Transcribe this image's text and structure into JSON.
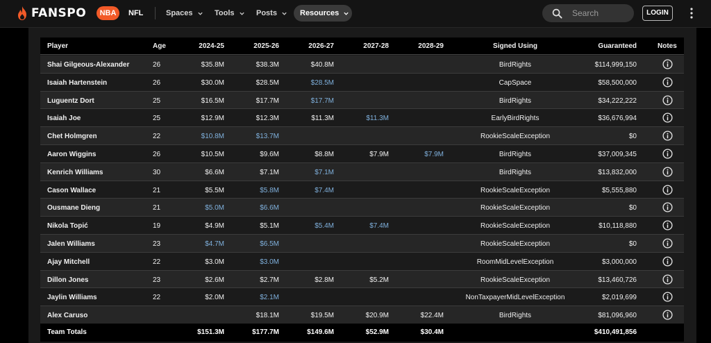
{
  "header": {
    "brand": "FANSPO",
    "league_active": "NBA",
    "league_other": "NFL",
    "nav": [
      "Spaces",
      "Tools",
      "Posts"
    ],
    "nav_active": "Resources",
    "search_placeholder": "Search",
    "login_label": "LOGIN",
    "accent_color": "#f25a28"
  },
  "table": {
    "columns": [
      "Player",
      "Age",
      "2024-25",
      "2025-26",
      "2026-27",
      "2027-28",
      "2028-29",
      "Signed Using",
      "Guaranteed",
      "Notes"
    ],
    "rows": [
      {
        "player": "Shai Gilgeous-Alexander",
        "age": "26",
        "y1": "$35.8M",
        "y2": "$38.3M",
        "y3": "$40.8M",
        "y4": "",
        "y5": "",
        "signed": "BirdRights",
        "guaranteed": "$114,999,150",
        "blue": []
      },
      {
        "player": "Isaiah Hartenstein",
        "age": "26",
        "y1": "$30.0M",
        "y2": "$28.5M",
        "y3": "$28.5M",
        "y4": "",
        "y5": "",
        "signed": "CapSpace",
        "guaranteed": "$58,500,000",
        "blue": [
          "y3"
        ]
      },
      {
        "player": "Luguentz Dort",
        "age": "25",
        "y1": "$16.5M",
        "y2": "$17.7M",
        "y3": "$17.7M",
        "y4": "",
        "y5": "",
        "signed": "BirdRights",
        "guaranteed": "$34,222,222",
        "blue": [
          "y3"
        ]
      },
      {
        "player": "Isaiah Joe",
        "age": "25",
        "y1": "$12.9M",
        "y2": "$12.3M",
        "y3": "$11.3M",
        "y4": "$11.3M",
        "y5": "",
        "signed": "EarlyBirdRights",
        "guaranteed": "$36,676,994",
        "blue": [
          "y4"
        ]
      },
      {
        "player": "Chet Holmgren",
        "age": "22",
        "y1": "$10.8M",
        "y2": "$13.7M",
        "y3": "",
        "y4": "",
        "y5": "",
        "signed": "RookieScaleException",
        "guaranteed": "$0",
        "blue": [
          "y1",
          "y2"
        ]
      },
      {
        "player": "Aaron Wiggins",
        "age": "26",
        "y1": "$10.5M",
        "y2": "$9.6M",
        "y3": "$8.8M",
        "y4": "$7.9M",
        "y5": "$7.9M",
        "signed": "BirdRights",
        "guaranteed": "$37,009,345",
        "blue": [
          "y5"
        ]
      },
      {
        "player": "Kenrich Williams",
        "age": "30",
        "y1": "$6.6M",
        "y2": "$7.1M",
        "y3": "$7.1M",
        "y4": "",
        "y5": "",
        "signed": "BirdRights",
        "guaranteed": "$13,832,000",
        "blue": [
          "y3"
        ]
      },
      {
        "player": "Cason Wallace",
        "age": "21",
        "y1": "$5.5M",
        "y2": "$5.8M",
        "y3": "$7.4M",
        "y4": "",
        "y5": "",
        "signed": "RookieScaleException",
        "guaranteed": "$5,555,880",
        "blue": [
          "y2",
          "y3"
        ]
      },
      {
        "player": "Ousmane Dieng",
        "age": "21",
        "y1": "$5.0M",
        "y2": "$6.6M",
        "y3": "",
        "y4": "",
        "y5": "",
        "signed": "RookieScaleException",
        "guaranteed": "$0",
        "blue": [
          "y1",
          "y2"
        ]
      },
      {
        "player": "Nikola Topić",
        "age": "19",
        "y1": "$4.9M",
        "y2": "$5.1M",
        "y3": "$5.4M",
        "y4": "$7.4M",
        "y5": "",
        "signed": "RookieScaleException",
        "guaranteed": "$10,118,880",
        "blue": [
          "y3",
          "y4"
        ]
      },
      {
        "player": "Jalen Williams",
        "age": "23",
        "y1": "$4.7M",
        "y2": "$6.5M",
        "y3": "",
        "y4": "",
        "y5": "",
        "signed": "RookieScaleException",
        "guaranteed": "$0",
        "blue": [
          "y1",
          "y2"
        ]
      },
      {
        "player": "Ajay Mitchell",
        "age": "22",
        "y1": "$3.0M",
        "y2": "$3.0M",
        "y3": "",
        "y4": "",
        "y5": "",
        "signed": "RoomMidLevelException",
        "guaranteed": "$3,000,000",
        "blue": [
          "y2"
        ]
      },
      {
        "player": "Dillon Jones",
        "age": "23",
        "y1": "$2.6M",
        "y2": "$2.7M",
        "y3": "$2.8M",
        "y4": "$5.2M",
        "y5": "",
        "signed": "RookieScaleException",
        "guaranteed": "$13,460,726",
        "blue": []
      },
      {
        "player": "Jaylin Williams",
        "age": "22",
        "y1": "$2.0M",
        "y2": "$2.1M",
        "y3": "",
        "y4": "",
        "y5": "",
        "signed": "NonTaxpayerMidLevelException",
        "guaranteed": "$2,019,699",
        "blue": [
          "y2"
        ]
      },
      {
        "player": "Alex Caruso",
        "age": "",
        "y1": "",
        "y2": "$18.1M",
        "y3": "$19.5M",
        "y4": "$20.9M",
        "y5": "$22.4M",
        "signed": "BirdRights",
        "guaranteed": "$81,096,960",
        "blue": []
      }
    ],
    "totals": {
      "label": "Team Totals",
      "y1": "$151.3M",
      "y2": "$177.7M",
      "y3": "$149.6M",
      "y4": "$52.9M",
      "y5": "$30.4M",
      "guaranteed": "$410,491,856"
    },
    "highlight_color": "#7fb0dc"
  }
}
